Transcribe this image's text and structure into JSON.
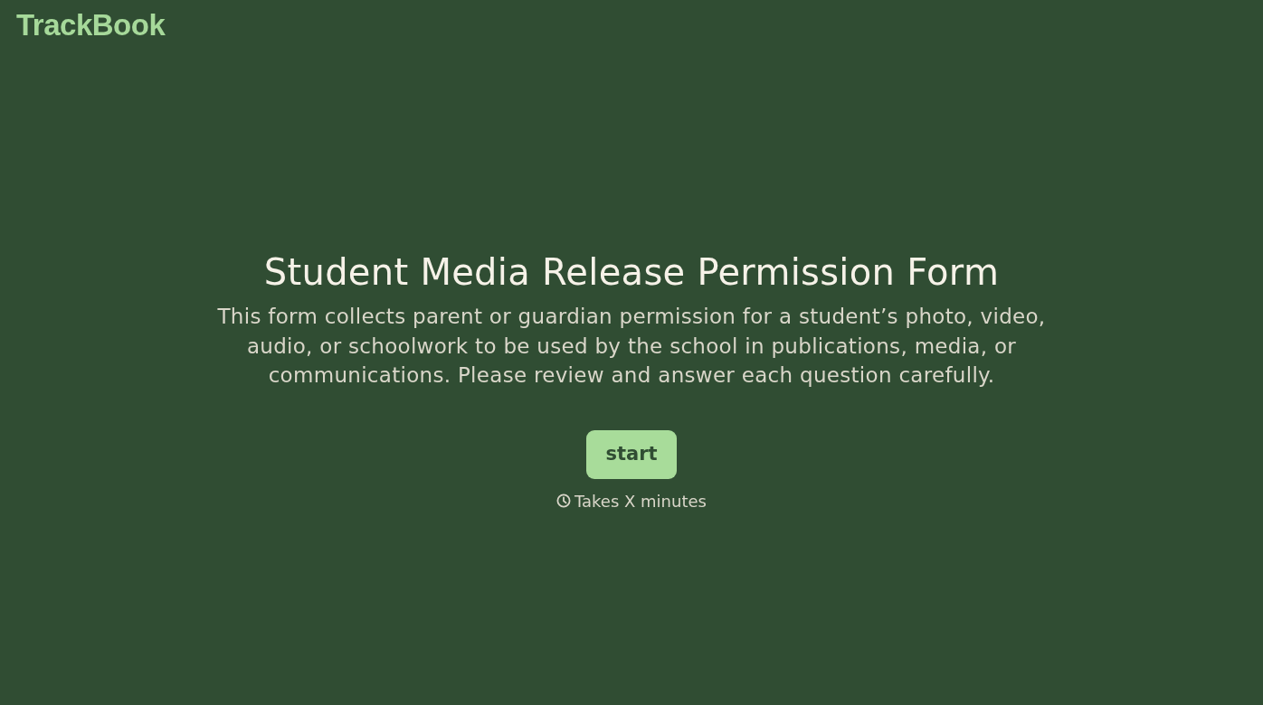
{
  "brand": {
    "logo": "TrackBook"
  },
  "intro": {
    "title": "Student Media Release Permission Form",
    "description": "This form collects parent or guardian permission for a student’s photo, video, audio, or schoolwork to be used by the school in publications, media, or communications. Please review and answer each question carefully.",
    "start_button": "start",
    "duration": "Takes X minutes"
  }
}
